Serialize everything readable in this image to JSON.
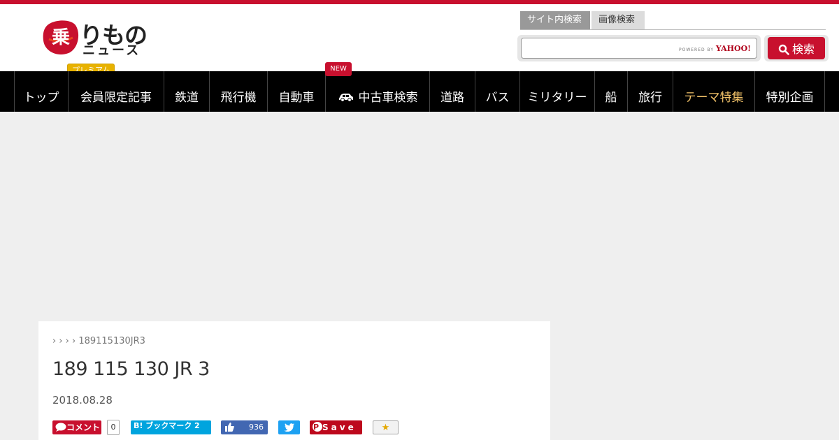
{
  "header": {
    "logo_mark_char": "乗",
    "logo_ri": "りもの",
    "logo_news": "ニュース",
    "premium_label": "プレミアム"
  },
  "search": {
    "tab_site": "サイト内検索",
    "tab_image": "画像検索",
    "input_value": "",
    "powered_by": "POWERED BY",
    "powered_brand": "YAHOO!",
    "button_label": "検索"
  },
  "nav": {
    "items": [
      {
        "label": "トップ"
      },
      {
        "label": "会員限定記事"
      },
      {
        "label": "鉄道"
      },
      {
        "label": "飛行機"
      },
      {
        "label": "自動車"
      },
      {
        "label": "中古車検索"
      },
      {
        "label": "道路"
      },
      {
        "label": "バス"
      },
      {
        "label": "ミリタリー"
      },
      {
        "label": "船"
      },
      {
        "label": "旅行"
      },
      {
        "label": "テーマ特集"
      },
      {
        "label": "特別企画"
      }
    ],
    "new_badge": "NEW",
    "highlight_color": "#f4c46a"
  },
  "article": {
    "breadcrumb": "› › › › 189115130JR3",
    "title": "189 115 130 JR 3",
    "date": "2018.08.28"
  },
  "share": {
    "comment_label": "コメント",
    "comment_count": "0",
    "hatena_label": "B! ブックマーク 2",
    "like_count": "936",
    "save_label": "Save",
    "fav_icon": "★"
  },
  "colors": {
    "brand_red": "#c8102e",
    "nav_bg": "#000000",
    "hatena_blue": "#00a4de",
    "facebook_blue": "#4267b2",
    "twitter_blue": "#1da1f2",
    "pinterest_red": "#bd081c"
  }
}
